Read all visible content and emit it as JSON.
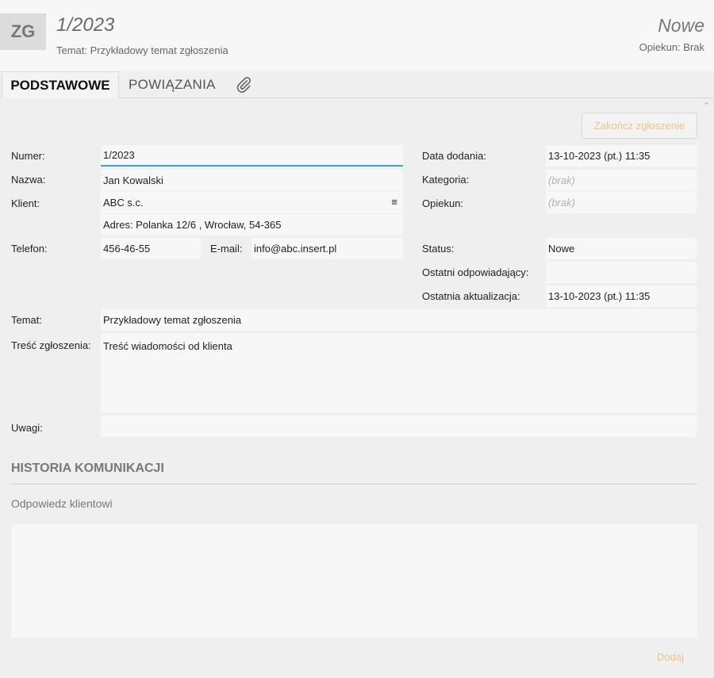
{
  "header": {
    "badge": "ZG",
    "number": "1/2023",
    "subject": "Temat: Przykładowy temat zgłoszenia",
    "status": "Nowe",
    "owner": "Opiekun: Brak"
  },
  "tabs": [
    {
      "label": "PODSTAWOWE",
      "active": true
    },
    {
      "label": "POWIĄZANIA",
      "active": false
    }
  ],
  "icons": {
    "attachment": "paperclip-icon",
    "client_menu": "menu-icon",
    "scroll": "chevron-up-icon"
  },
  "actions": {
    "finish": "Zakończ zgłoszenie",
    "add": "Dodaj"
  },
  "form": {
    "number": {
      "label": "Numer:",
      "value": "1/2023"
    },
    "name": {
      "label": "Nazwa:",
      "value": "Jan Kowalski"
    },
    "client": {
      "label": "Klient:",
      "value": "ABC s.c.",
      "address": "Adres:  Polanka  12/6 , Wrocław, 54-365"
    },
    "phone": {
      "label": "Telefon:",
      "value": "456-46-55"
    },
    "email": {
      "label": "E-mail:",
      "value": "info@abc.insert.pl"
    },
    "date_added": {
      "label": "Data dodania:",
      "value": "13-10-2023 (pt.) 11:35"
    },
    "category": {
      "label": "Kategoria:",
      "value": "(brak)"
    },
    "caretaker": {
      "label": "Opiekun:",
      "value": "(brak)"
    },
    "status": {
      "label": "Status:",
      "value": "Nowe"
    },
    "last_responder": {
      "label": "Ostatni odpowiadający:",
      "value": ""
    },
    "last_update": {
      "label": "Ostatnia aktualizacja:",
      "value": "13-10-2023 (pt.) 11:35"
    },
    "subject": {
      "label": "Temat:",
      "value": "Przykładowy temat zgłoszenia"
    },
    "content": {
      "label": "Treść zgłoszenia:",
      "value": "Treść wiadomości od klienta"
    },
    "notes": {
      "label": "Uwagi:",
      "value": ""
    }
  },
  "history": {
    "title": "HISTORIA KOMUNIKACJI",
    "reply_label": "Odpowiedz klientowi",
    "reply_value": ""
  },
  "colors": {
    "accent": "#3aa3d6",
    "action_disabled": "#f1c28a"
  }
}
